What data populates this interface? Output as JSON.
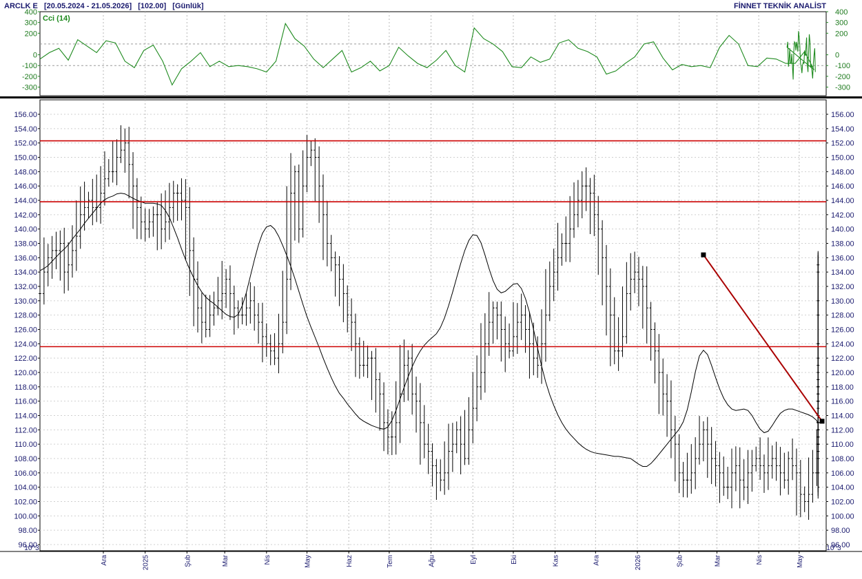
{
  "header": {
    "symbol": "ARCLK E",
    "range": "[20.05.2024 - 21.05.2026]",
    "last": "[102.00]",
    "period": "[Günlük]",
    "brand": "FİNNET TEKNİK ANALİST"
  },
  "scale_badge": "10^3",
  "colors": {
    "price": "#000000",
    "ma": "#000000",
    "cci": "#1e8a1e",
    "levels": "#cc0000",
    "trendline": "#aa0000",
    "axis_text": "#1a1a6e"
  },
  "chart_data": [
    {
      "type": "line",
      "indicator": "Cci (14)",
      "ylim": [
        -380,
        400
      ],
      "yticks": [
        400,
        300,
        200,
        0,
        -100,
        -200,
        -300
      ],
      "reference_lines": [
        100,
        -100
      ],
      "series": [
        {
          "name": "Cci (14)",
          "x_start": "2024-10-15",
          "step_days": 7,
          "values": [
            -40,
            20,
            60,
            -50,
            140,
            80,
            20,
            130,
            110,
            -60,
            -120,
            40,
            90,
            -60,
            -280,
            -130,
            -60,
            20,
            -110,
            -60,
            -110,
            -100,
            -110,
            -130,
            -160,
            -60,
            290,
            150,
            80,
            -40,
            -120,
            -40,
            40,
            -160,
            -120,
            -60,
            -150,
            -100,
            70,
            -10,
            -80,
            -120,
            -50,
            40,
            -100,
            -160,
            250,
            150,
            100,
            30,
            -110,
            -120,
            -20,
            -70,
            -40,
            110,
            140,
            60,
            30,
            -20,
            -180,
            -150,
            -80,
            -20,
            100,
            120,
            -30,
            -140,
            -90,
            -110,
            -100,
            -120,
            70,
            180,
            100,
            -100,
            -110,
            -30,
            -40,
            -80,
            -80,
            30,
            -140,
            70,
            120,
            -110,
            -50,
            60,
            -80,
            -80,
            10,
            -110,
            -230,
            30,
            120,
            110,
            40,
            120,
            80,
            30,
            220,
            160,
            80,
            -80,
            -110,
            -170,
            -90,
            -70,
            -80,
            40,
            -10,
            60,
            160,
            -90,
            -160,
            40,
            190,
            120,
            -120,
            -90,
            -160,
            -220,
            -80,
            0,
            60,
            -160
          ]
        }
      ]
    },
    {
      "type": "ohlc",
      "ylim": [
        96,
        157
      ],
      "yticks": [
        156.0,
        154.0,
        152.0,
        150.0,
        148.0,
        146.0,
        144.0,
        142.0,
        140.0,
        138.0,
        136.0,
        134.0,
        132.0,
        130.0,
        128.0,
        126.0,
        124.0,
        122.0,
        120.0,
        118.0,
        116.0,
        114.0,
        112.0,
        110.0,
        108.0,
        106.0,
        104.0,
        102.0,
        100.0,
        98.0,
        96.0
      ],
      "xticks": [
        "Ara",
        "2025",
        "Şub",
        "Mar",
        "Nis",
        "May",
        "Haz",
        "Tem",
        "Ağu",
        "Eyl",
        "Eki",
        "Kas",
        "Ara",
        "2026",
        "Şub",
        "Mar",
        "Nis",
        "May"
      ],
      "horizontal_levels": [
        152.3,
        143.8,
        123.6
      ],
      "trendline": [
        {
          "date": "2026-02-19",
          "value": 136.4
        },
        {
          "date": "2026-05-21",
          "value": 113.2
        }
      ],
      "series": [
        {
          "name": "Fiyat",
          "x_start": "2024-10-15",
          "step_days": 3,
          "values": [
            131,
            134,
            136,
            137,
            137,
            138,
            134,
            135,
            137,
            139,
            142,
            143,
            144,
            143,
            143,
            145,
            147,
            148,
            148,
            150,
            151,
            152,
            149,
            146,
            143,
            141,
            140,
            141,
            142,
            142,
            140,
            141,
            143,
            145,
            145,
            144,
            143,
            137,
            133,
            129,
            127,
            126,
            128,
            129,
            130,
            131,
            133,
            131,
            129,
            128,
            128,
            129,
            130,
            128,
            127,
            125,
            124,
            123,
            122,
            124,
            127,
            133,
            145,
            148,
            140,
            146,
            150,
            151,
            150,
            146,
            142,
            138,
            136,
            135,
            133,
            131,
            128,
            127,
            124,
            121,
            121,
            122,
            122,
            119,
            117,
            113,
            111,
            111,
            113,
            117,
            121,
            122,
            117,
            116,
            113,
            110,
            109,
            107,
            106,
            105,
            106,
            109,
            110,
            112,
            110,
            108,
            112,
            115,
            118,
            120,
            124,
            127,
            129,
            128,
            126,
            124,
            123,
            125,
            127,
            128,
            126,
            124,
            122,
            121,
            124,
            128,
            132,
            134,
            136,
            138,
            138,
            140,
            142,
            144,
            146,
            146,
            145,
            142,
            140,
            136,
            132,
            128,
            123,
            123,
            125,
            131,
            133,
            134,
            133,
            132,
            129,
            126,
            123,
            120,
            117,
            116,
            112,
            110,
            106,
            105,
            105,
            106,
            108,
            110,
            112,
            110,
            108,
            107,
            106,
            104,
            104,
            106,
            107,
            105,
            104,
            106,
            107,
            108,
            107,
            106,
            107,
            108,
            107,
            106,
            105,
            108,
            107,
            106,
            103,
            102,
            103,
            106,
            108,
            110,
            111,
            112,
            113,
            112,
            113,
            114,
            116,
            117,
            116,
            118,
            119,
            120,
            122,
            124,
            128,
            134,
            135,
            130,
            124,
            121,
            118,
            116,
            113,
            110,
            108,
            108,
            110,
            111,
            112,
            113,
            114,
            114,
            113,
            111,
            110,
            109,
            108,
            108,
            109,
            110,
            114,
            118,
            119,
            118,
            117,
            116,
            115,
            114,
            114,
            113,
            114,
            113,
            112,
            113,
            114,
            110,
            106,
            104
          ]
        },
        {
          "name": "Ortalama",
          "x_start": "2024-10-15",
          "step_days": 3,
          "values": [
            134.2,
            134.5,
            134.9,
            135.5,
            136.1,
            136.7,
            137.2,
            137.8,
            138.6,
            139.3,
            140.0,
            140.8,
            141.5,
            142.2,
            142.9,
            143.6,
            144.1,
            144.4,
            144.6,
            144.9,
            145.0,
            144.9,
            144.6,
            144.3,
            144.0,
            143.8,
            143.6,
            143.6,
            143.6,
            143.5,
            143.3,
            142.6,
            141.6,
            140.2,
            138.8,
            137.2,
            135.7,
            134.4,
            133.2,
            132.1,
            131.2,
            130.5,
            130.0,
            129.6,
            129.1,
            128.6,
            128.1,
            127.8,
            127.7,
            128.1,
            129.3,
            131.1,
            133.4,
            135.7,
            137.8,
            139.4,
            140.3,
            140.5,
            140.0,
            139.0,
            137.7,
            136.3,
            134.8,
            133.1,
            131.3,
            129.5,
            127.8,
            126.3,
            124.9,
            123.5,
            122.0,
            120.6,
            119.3,
            118.1,
            117.1,
            116.4,
            115.6,
            114.9,
            114.2,
            113.6,
            113.2,
            112.9,
            112.6,
            112.4,
            112.2,
            112.1,
            112.4,
            113.3,
            114.7,
            116.3,
            117.9,
            119.4,
            120.8,
            122.0,
            123.0,
            123.8,
            124.4,
            124.9,
            125.4,
            126.3,
            127.6,
            129.3,
            131.2,
            133.2,
            135.2,
            137.0,
            138.4,
            139.2,
            139.1,
            138.1,
            136.4,
            134.5,
            132.8,
            131.6,
            131.1,
            131.3,
            131.8,
            132.3,
            132.4,
            131.7,
            130.3,
            128.4,
            126.0,
            123.4,
            120.9,
            118.7,
            116.9,
            115.4,
            114.1,
            113.0,
            112.1,
            111.4,
            110.8,
            110.2,
            109.7,
            109.3,
            109.0,
            108.8,
            108.7,
            108.6,
            108.5,
            108.4,
            108.3,
            108.3,
            108.2,
            108.1,
            108.0,
            107.6,
            107.2,
            106.9,
            106.9,
            107.3,
            107.9,
            108.6,
            109.3,
            110.0,
            110.7,
            111.4,
            112.1,
            113.1,
            114.8,
            117.3,
            120.1,
            122.3,
            123.1,
            122.5,
            121.0,
            119.3,
            117.7,
            116.4,
            115.5,
            114.9,
            114.7,
            114.8,
            114.9,
            114.7,
            114.0,
            113.0,
            112.1,
            111.6,
            111.8,
            112.6,
            113.5,
            114.3,
            114.7,
            114.9,
            114.9,
            114.7,
            114.5,
            114.3,
            114.1,
            113.8,
            113.3,
            112.8,
            112.5
          ]
        }
      ]
    }
  ]
}
